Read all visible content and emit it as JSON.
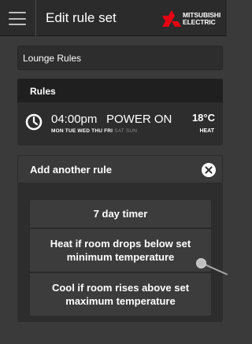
{
  "header": {
    "title": "Edit rule set",
    "logo_line1": "MITSUBISHI",
    "logo_line2": "ELECTRIC",
    "logo_color": "#e60012"
  },
  "rule_set": {
    "name_value": "Lounge Rules"
  },
  "rules_panel": {
    "title": "Rules",
    "rule": {
      "time": "04:00pm",
      "action": "POWER ON",
      "days_active": "MON TUE WED THU FRI",
      "days_inactive": "SAT SUN",
      "temperature": "18°C",
      "mode": "HEAT"
    }
  },
  "add_panel": {
    "title": "Add another rule",
    "options": [
      "7 day timer",
      "Heat if room drops below set minimum temperature",
      "Cool if room rises above set maximum temperature"
    ]
  },
  "icons": [
    "menu-icon",
    "clock-icon",
    "close-icon",
    "mitsubishi-logo-icon"
  ]
}
